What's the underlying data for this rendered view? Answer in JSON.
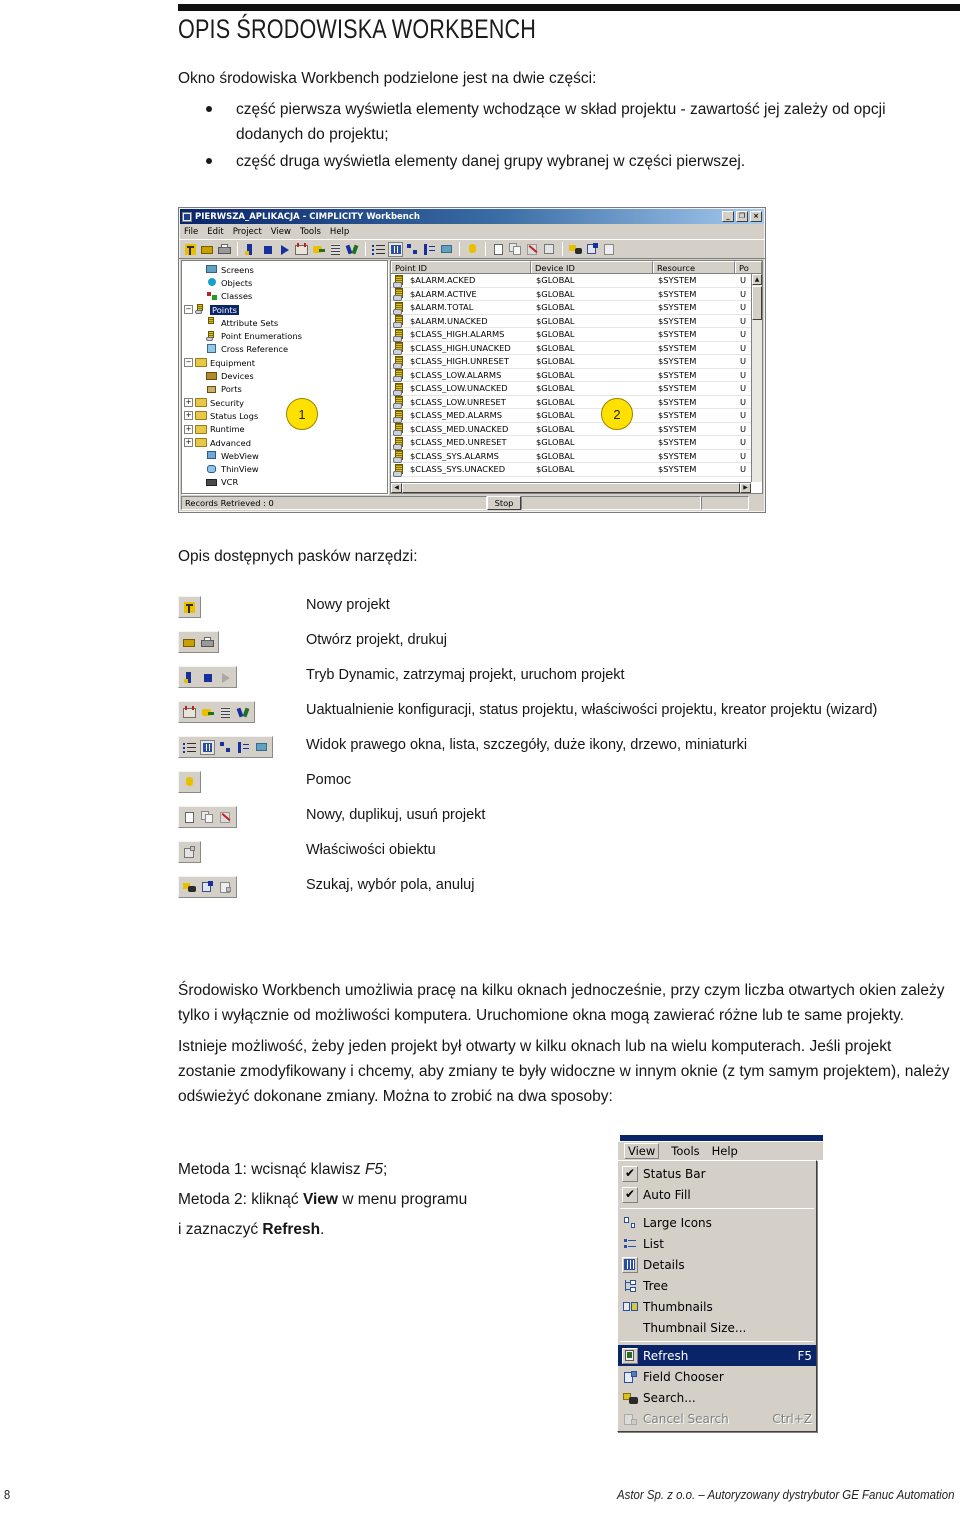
{
  "document": {
    "title": "OPIS ŚRODOWISKA WORKBENCH",
    "intro_lead": "Okno środowiska Workbench podzielone jest na dwie części:",
    "bullets": [
      "część pierwsza wyświetla elementy wchodzące w skład projektu - zawartość jej zależy od opcji dodanych do projektu;",
      "część druga wyświetla elementy danej grupy wybranej w części pierwszej."
    ],
    "toolbars_heading": "Opis dostępnych pasków narzędzi:",
    "paragraphs": [
      "Środowisko Workbench umożliwia pracę na kilku oknach jednocześnie, przy czym liczba otwartych okien zależy tylko i wyłącznie od możliwości komputera. Uruchomione okna mogą zawierać różne lub te same projekty.",
      "Istnieje możliwość, żeby jeden projekt był otwarty w kilku oknach lub na wielu komputerach. Jeśli projekt zostanie zmodyfikowany i chcemy, aby zmiany te były widoczne w innym oknie (z tym samym projektem), należy odświeżyć dokonane zmiany. Można to zrobić na dwa sposoby:"
    ],
    "methods": {
      "m1_prefix": "Metoda 1: wcisnąć klawisz ",
      "m1_key": "F5",
      "m1_suffix": ";",
      "m2_prefix": "Metoda 2: kliknąć ",
      "m2_bold": "View",
      "m2_mid": " w menu programu",
      "m3_prefix": "i zaznaczyć ",
      "m3_bold": "Refresh",
      "m3_suffix": "."
    },
    "footer": {
      "page_number": "8",
      "text": "Astor Sp. z o.o. – Autoryzowany dystrybutor GE Fanuc Automation"
    }
  },
  "workbench": {
    "window_title": "PIERWSZA_APLIKACJA - CIMPLICITY Workbench",
    "window_buttons": [
      "_",
      "❐",
      "×"
    ],
    "menu": [
      "File",
      "Edit",
      "Project",
      "View",
      "Tools",
      "Help"
    ],
    "toolbar_icons": [
      "new-project-icon",
      "open-project-icon",
      "print-icon",
      "dynamic-mode-icon",
      "stop-project-icon",
      "run-project-icon",
      "update-config-icon",
      "project-status-icon",
      "project-properties-icon",
      "project-wizard-icon",
      "right-pane-view-icon",
      "list-view-icon",
      "details-view-icon",
      "large-icons-icon",
      "tree-view-icon",
      "thumbnails-icon",
      "help-icon",
      "new-object-icon",
      "duplicate-object-icon",
      "delete-object-icon",
      "search-icon",
      "field-chooser-icon",
      "cancel-search-icon"
    ],
    "tree": [
      {
        "label": "Screens",
        "indent": 1,
        "expander": "",
        "icon": "screens-icon",
        "selected": false
      },
      {
        "label": "Objects",
        "indent": 1,
        "expander": "",
        "icon": "objects-icon",
        "selected": false
      },
      {
        "label": "Classes",
        "indent": 1,
        "expander": "",
        "icon": "classes-icon",
        "selected": false
      },
      {
        "label": "Points",
        "indent": 0,
        "expander": "-",
        "icon": "points-icon",
        "selected": true
      },
      {
        "label": "Attribute Sets",
        "indent": 2,
        "expander": "",
        "icon": "attribute-sets-icon",
        "selected": false
      },
      {
        "label": "Point Enumerations",
        "indent": 2,
        "expander": "",
        "icon": "point-enumerations-icon",
        "selected": false
      },
      {
        "label": "Cross Reference",
        "indent": 2,
        "expander": "",
        "icon": "cross-reference-icon",
        "selected": false
      },
      {
        "label": "Equipment",
        "indent": 0,
        "expander": "-",
        "icon": "folder-icon",
        "selected": false
      },
      {
        "label": "Devices",
        "indent": 2,
        "expander": "",
        "icon": "devices-icon",
        "selected": false
      },
      {
        "label": "Ports",
        "indent": 2,
        "expander": "",
        "icon": "ports-icon",
        "selected": false
      },
      {
        "label": "Security",
        "indent": 0,
        "expander": "+",
        "icon": "folder-icon",
        "selected": false
      },
      {
        "label": "Status Logs",
        "indent": 0,
        "expander": "+",
        "icon": "folder-icon",
        "selected": false
      },
      {
        "label": "Runtime",
        "indent": 0,
        "expander": "+",
        "icon": "folder-icon",
        "selected": false
      },
      {
        "label": "Advanced",
        "indent": 0,
        "expander": "+",
        "icon": "folder-icon",
        "selected": false
      },
      {
        "label": "WebView",
        "indent": 1,
        "expander": "",
        "icon": "webview-icon",
        "selected": false
      },
      {
        "label": "ThinView",
        "indent": 1,
        "expander": "",
        "icon": "thinview-icon",
        "selected": false
      },
      {
        "label": "VCR",
        "indent": 1,
        "expander": "",
        "icon": "vcr-icon",
        "selected": false
      }
    ],
    "list_columns": [
      "Point ID",
      "Device ID",
      "Resource",
      "Po"
    ],
    "list_rows": [
      [
        "$ALARM.ACKED",
        "$GLOBAL",
        "$SYSTEM",
        "U"
      ],
      [
        "$ALARM.ACTIVE",
        "$GLOBAL",
        "$SYSTEM",
        "U"
      ],
      [
        "$ALARM.TOTAL",
        "$GLOBAL",
        "$SYSTEM",
        "U"
      ],
      [
        "$ALARM.UNACKED",
        "$GLOBAL",
        "$SYSTEM",
        "U"
      ],
      [
        "$CLASS_HIGH.ALARMS",
        "$GLOBAL",
        "$SYSTEM",
        "U"
      ],
      [
        "$CLASS_HIGH.UNACKED",
        "$GLOBAL",
        "$SYSTEM",
        "U"
      ],
      [
        "$CLASS_HIGH.UNRESET",
        "$GLOBAL",
        "$SYSTEM",
        "U"
      ],
      [
        "$CLASS_LOW.ALARMS",
        "$GLOBAL",
        "$SYSTEM",
        "U"
      ],
      [
        "$CLASS_LOW.UNACKED",
        "$GLOBAL",
        "$SYSTEM",
        "U"
      ],
      [
        "$CLASS_LOW.UNRESET",
        "$GLOBAL",
        "$SYSTEM",
        "U"
      ],
      [
        "$CLASS_MED.ALARMS",
        "$GLOBAL",
        "$SYSTEM",
        "U"
      ],
      [
        "$CLASS_MED.UNACKED",
        "$GLOBAL",
        "$SYSTEM",
        "U"
      ],
      [
        "$CLASS_MED.UNRESET",
        "$GLOBAL",
        "$SYSTEM",
        "U"
      ],
      [
        "$CLASS_SYS.ALARMS",
        "$GLOBAL",
        "$SYSTEM",
        "U"
      ],
      [
        "$CLASS_SYS.UNACKED",
        "$GLOBAL",
        "$SYSTEM",
        "U"
      ]
    ],
    "status": {
      "records": "Records Retrieved : 0",
      "stop": "Stop"
    },
    "callouts": [
      "1",
      "2"
    ]
  },
  "toolbar_legend": [
    {
      "icons": [
        "new-project-icon"
      ],
      "description": "Nowy projekt"
    },
    {
      "icons": [
        "open-project-icon",
        "print-icon"
      ],
      "description": "Otwórz projekt, drukuj"
    },
    {
      "icons": [
        "dynamic-mode-icon",
        "stop-project-icon",
        "run-project-icon"
      ],
      "description": "Tryb Dynamic, zatrzymaj projekt, uruchom projekt"
    },
    {
      "icons": [
        "update-config-icon",
        "project-status-icon",
        "project-properties-icon",
        "project-wizard-icon"
      ],
      "description": "Uaktualnienie konfiguracji, status projektu, właściwości projektu, kreator projektu (wizard)"
    },
    {
      "icons": [
        "right-pane-view-icon",
        "list-view-icon",
        "details-view-icon",
        "large-icons-icon",
        "tree-view-icon"
      ],
      "description": "Widok prawego okna, lista, szczegóły, duże ikony, drzewo, miniaturki"
    },
    {
      "icons": [
        "help-icon"
      ],
      "description": "Pomoc"
    },
    {
      "icons": [
        "new-object-icon",
        "duplicate-object-icon",
        "delete-object-icon"
      ],
      "description": "Nowy, duplikuj, usuń projekt"
    },
    {
      "icons": [
        "object-properties-icon"
      ],
      "description": "Właściwości obiektu"
    },
    {
      "icons": [
        "search-icon",
        "field-chooser-icon",
        "cancel-search-icon"
      ],
      "description": "Szukaj, wybór pola, anuluj"
    }
  ],
  "view_menu": {
    "menubar": [
      "View",
      "Tools",
      "Help"
    ],
    "active": "View",
    "items": [
      {
        "label": "Status Bar",
        "checked": true,
        "icon": "",
        "accel": "",
        "highlight": false,
        "disabled": false,
        "sep_after": false
      },
      {
        "label": "Auto Fill",
        "checked": true,
        "icon": "",
        "accel": "",
        "highlight": false,
        "disabled": false,
        "sep_after": true
      },
      {
        "label": "Large Icons",
        "checked": false,
        "icon": "large-icons-icon",
        "accel": "",
        "highlight": false,
        "disabled": false,
        "sep_after": false
      },
      {
        "label": "List",
        "checked": false,
        "icon": "list-view-icon",
        "accel": "",
        "highlight": false,
        "disabled": false,
        "sep_after": false
      },
      {
        "label": "Details",
        "checked": false,
        "icon": "details-view-icon",
        "accel": "",
        "highlight": false,
        "disabled": false,
        "sep_after": false
      },
      {
        "label": "Tree",
        "checked": false,
        "icon": "tree-view-icon",
        "accel": "",
        "highlight": false,
        "disabled": false,
        "sep_after": false
      },
      {
        "label": "Thumbnails",
        "checked": false,
        "icon": "thumbnails-icon",
        "accel": "",
        "highlight": false,
        "disabled": false,
        "sep_after": false
      },
      {
        "label": "Thumbnail Size...",
        "checked": false,
        "icon": "",
        "accel": "",
        "highlight": false,
        "disabled": false,
        "sep_after": true
      },
      {
        "label": "Refresh",
        "checked": false,
        "icon": "refresh-icon",
        "accel": "F5",
        "highlight": true,
        "disabled": false,
        "sep_after": false
      },
      {
        "label": "Field Chooser",
        "checked": false,
        "icon": "field-chooser-icon",
        "accel": "",
        "highlight": false,
        "disabled": false,
        "sep_after": false
      },
      {
        "label": "Search...",
        "checked": false,
        "icon": "search-icon",
        "accel": "",
        "highlight": false,
        "disabled": false,
        "sep_after": false
      },
      {
        "label": "Cancel Search",
        "checked": false,
        "icon": "cancel-search-icon",
        "accel": "Ctrl+Z",
        "highlight": false,
        "disabled": true,
        "sep_after": false
      }
    ]
  },
  "colors": {
    "title_bar": "#0a246a",
    "window_face": "#d4d0c8",
    "callout": "#ffe100",
    "selection": "#0a246a",
    "rule": "#111111"
  }
}
